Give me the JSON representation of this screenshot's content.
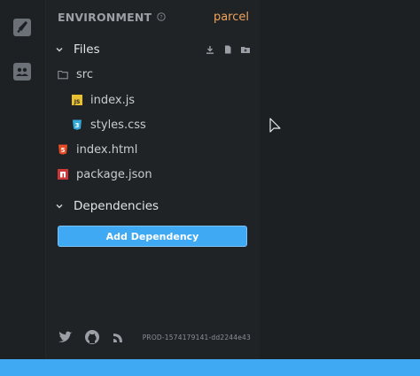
{
  "activity_bar": {
    "items": [
      {
        "icon": "rocket-icon"
      },
      {
        "icon": "people-icon"
      }
    ]
  },
  "header": {
    "title": "ENVIRONMENT",
    "template": "parcel"
  },
  "files_section": {
    "label": "Files",
    "actions": [
      "download-icon",
      "new-file-icon",
      "new-folder-icon"
    ],
    "tree": [
      {
        "name": "src",
        "icon": "folder-icon"
      },
      {
        "name": "index.js",
        "icon": "js-file-icon"
      },
      {
        "name": "styles.css",
        "icon": "css-file-icon"
      },
      {
        "name": "index.html",
        "icon": "html-file-icon"
      },
      {
        "name": "package.json",
        "icon": "npm-file-icon"
      }
    ]
  },
  "dependencies_section": {
    "label": "Dependencies",
    "add_button": "Add Dependency"
  },
  "footer": {
    "links": [
      "twitter-icon",
      "github-icon",
      "spectrum-icon"
    ],
    "version": "PROD-1574179141-dd2244e43"
  },
  "colors": {
    "accent": "#40a9f3",
    "template": "#f0a35a",
    "background": "#1c2022",
    "sidebar": "#1f2326"
  }
}
